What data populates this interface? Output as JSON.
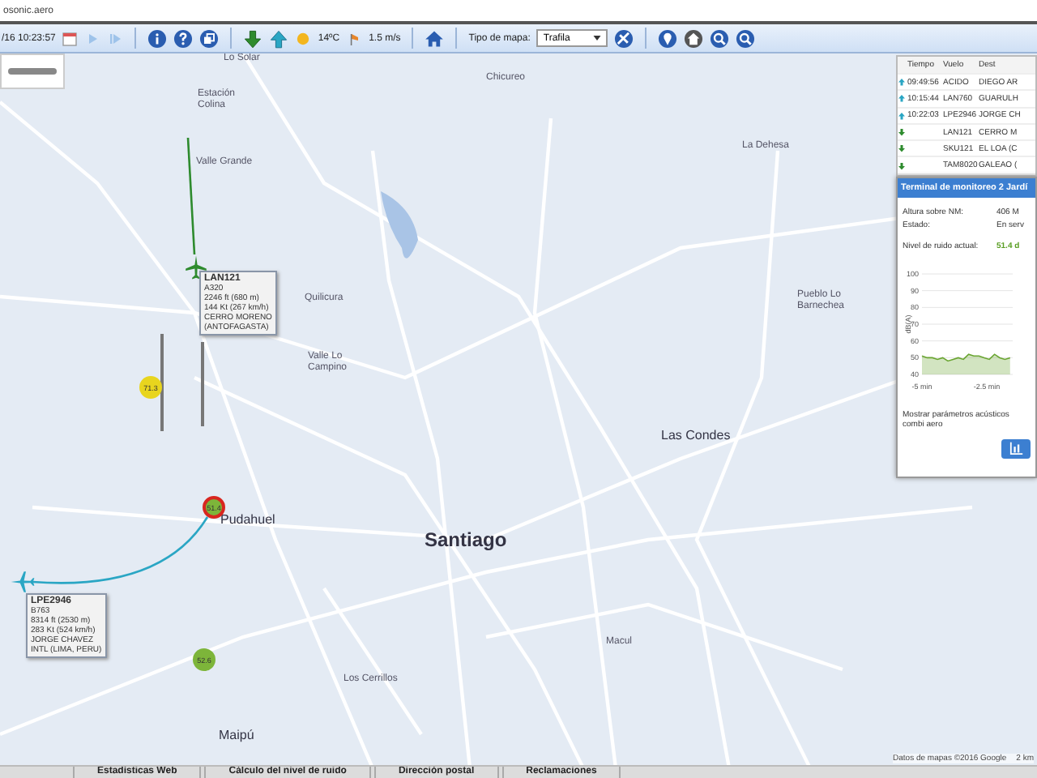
{
  "browser": {
    "url": "osonic.aero"
  },
  "toolbar": {
    "datetime": "/16 10:23:57",
    "temperature": "14ºC",
    "wind": "1.5 m/s",
    "map_type_label": "Tipo de mapa:",
    "map_type": "Trafila"
  },
  "map": {
    "places": [
      {
        "name": "Lo Solar",
        "kind": "locality"
      },
      {
        "name": "Estación Colina",
        "kind": "locality"
      },
      {
        "name": "Chicureo",
        "kind": "locality"
      },
      {
        "name": "La Dehesa",
        "kind": "locality"
      },
      {
        "name": "Valle Grande",
        "kind": "locality"
      },
      {
        "name": "Quilicura",
        "kind": "locality"
      },
      {
        "name": "Pueblo Lo Barnechea",
        "kind": "locality"
      },
      {
        "name": "Valle Lo Campino",
        "kind": "locality"
      },
      {
        "name": "Las Condes",
        "kind": "district"
      },
      {
        "name": "Pudahuel",
        "kind": "district"
      },
      {
        "name": "Santiago",
        "kind": "city"
      },
      {
        "name": "Macul",
        "kind": "locality"
      },
      {
        "name": "Los Cerrillos",
        "kind": "locality"
      },
      {
        "name": "Maipú",
        "kind": "district"
      }
    ],
    "flights": [
      {
        "callsign": "LAN121",
        "kind": "arrival",
        "lines": [
          "A320",
          "2246 ft (680 m)",
          "144 Kt (267 km/h)",
          "CERRO MORENO",
          "(ANTOFAGASTA)"
        ]
      },
      {
        "callsign": "LPE2946",
        "kind": "departure",
        "lines": [
          "B763",
          "8314 ft (2530 m)",
          "283 Kt (524 km/h)",
          "JORGE CHAVEZ",
          "INTL (LIMA, PERU)"
        ]
      }
    ],
    "monitors": [
      {
        "reading": "71.3",
        "color": "#e8d51e",
        "alert": false
      },
      {
        "reading": "51.4",
        "color": "#7db53a",
        "alert": true
      },
      {
        "reading": "52.6",
        "color": "#7db53a",
        "alert": false
      }
    ],
    "attribution": "Datos de mapas ©2016 Google",
    "scale": "2 km"
  },
  "flights_table": {
    "columns": [
      "Tiempo",
      "Vuelo",
      "Dest"
    ],
    "rows": [
      {
        "kind": "departure",
        "time": "09:49:56",
        "flight": "ACIDO",
        "place": "DIEGO AR"
      },
      {
        "kind": "departure",
        "time": "10:15:44",
        "flight": "LAN760",
        "place": "GUARULH"
      },
      {
        "kind": "departure",
        "time": "10:22:03",
        "flight": "LPE2946",
        "place": "JORGE CH"
      },
      {
        "kind": "arrival",
        "time": "",
        "flight": "LAN121",
        "place": "CERRO M"
      },
      {
        "kind": "arrival",
        "time": "",
        "flight": "SKU121",
        "place": "EL LOA (C"
      },
      {
        "kind": "arrival",
        "time": "",
        "flight": "TAM8020",
        "place": "GALEAO ("
      }
    ]
  },
  "monitor_panel": {
    "title": "Terminal de monitoreo 2 Jardí",
    "fields": [
      {
        "label": "Altura sobre NM:",
        "value": "406 M"
      },
      {
        "label": "Estado:",
        "value": "En serv"
      }
    ],
    "noise_label": "Nivel de ruido actual:",
    "noise_value": "51.4 d",
    "chart_data": {
      "type": "area",
      "ylabel": "dB(A)",
      "x": [
        -5,
        -4.8,
        -4.6,
        -4.4,
        -4.2,
        -4,
        -3.8,
        -3.6,
        -3.4,
        -3.2,
        -3,
        -2.8,
        -2.6,
        -2.4,
        -2.2,
        -2,
        -1.8,
        -1.6
      ],
      "series": [
        {
          "color": "#6aa532",
          "values": [
            51,
            50,
            50,
            49,
            50,
            48,
            49,
            50,
            49,
            52,
            51,
            51,
            50,
            49,
            52,
            50,
            49,
            50
          ]
        }
      ],
      "xlim": [
        -5,
        -1.5
      ],
      "ylim": [
        40,
        100
      ],
      "grid": true,
      "yticks": [
        40,
        50,
        60,
        70,
        80,
        90,
        100
      ],
      "xticks": [
        {
          "value": -5,
          "label": "-5 min"
        },
        {
          "value": -2.5,
          "label": "-2.5 min"
        }
      ]
    },
    "note": "Mostrar parámetros acústicos combi aero"
  },
  "bottom_tabs": [
    "Estadísticas Web",
    "Cálculo del nivel de ruido",
    "Dirección postal",
    "Reclamaciones"
  ]
}
